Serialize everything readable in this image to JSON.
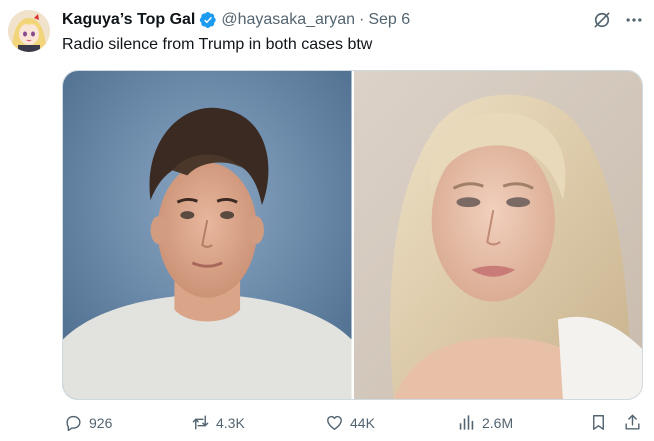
{
  "tweet": {
    "display_name": "Kaguya’s Top Gal",
    "handle": "@hayasaka_aryan",
    "separator": "·",
    "date": "Sep 6",
    "text": "Radio silence from Trump in both cases btw",
    "icons": {
      "avatar": "anime-avatar",
      "verified": "verified-badge-icon",
      "grok": "grok-icon",
      "more": "more-icon"
    },
    "media": [
      {
        "alt": "school portrait photo"
      },
      {
        "alt": "portrait photo"
      }
    ],
    "actions": {
      "replies": "926",
      "reposts": "4.3K",
      "likes": "44K",
      "views": "2.6M"
    },
    "colors": {
      "text": "#0f1419",
      "secondary": "#536471",
      "verified": "#1d9bf0",
      "border": "#cfd9de"
    }
  }
}
